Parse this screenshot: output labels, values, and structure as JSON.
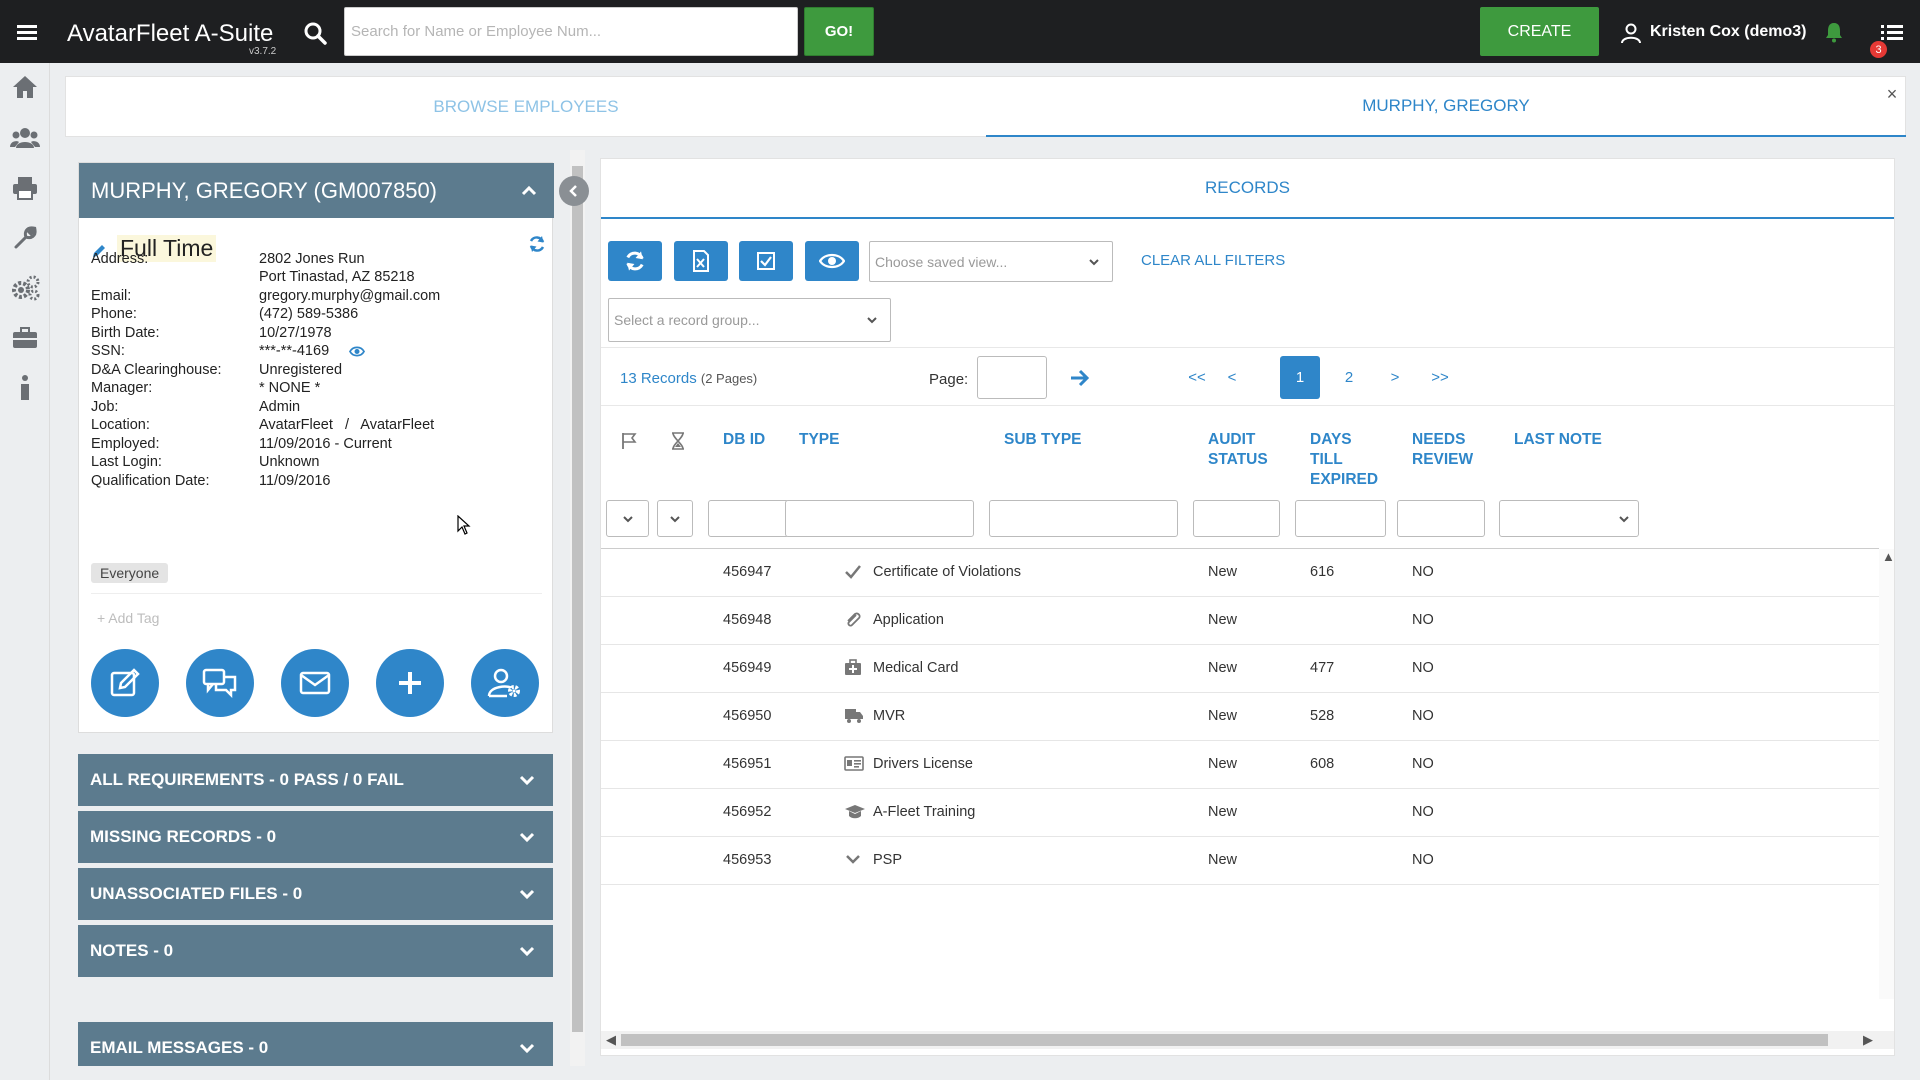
{
  "header": {
    "app_title": "AvatarFleet A-Suite",
    "version": "v3.7.2",
    "search_placeholder": "Search for Name or Employee Num...",
    "go_label": "GO!",
    "create_label": "CREATE",
    "user_name": "Kristen Cox (demo3)",
    "notification_count": "3"
  },
  "sidebar": {
    "items": [
      "home-icon",
      "users-icon",
      "print-icon",
      "wrench-icon",
      "gears-icon",
      "briefcase-icon",
      "info-icon"
    ]
  },
  "tabs": {
    "browse": "BROWSE EMPLOYEES",
    "employee": "MURPHY, GREGORY",
    "close": "×"
  },
  "employee": {
    "header": "MURPHY, GREGORY (GM007850)",
    "status": "Full Time",
    "fields": [
      {
        "label": "Address:",
        "value": "2802 Jones Run"
      },
      {
        "label": "",
        "value": "Port Tinastad, AZ 85218"
      },
      {
        "label": "Email:",
        "value": "gregory.murphy@gmail.com"
      },
      {
        "label": "Phone:",
        "value": "(472) 589-5386"
      },
      {
        "label": "Birth Date:",
        "value": "10/27/1978"
      },
      {
        "label": "SSN:",
        "value": "***-**-4169"
      },
      {
        "label": "D&A Clearinghouse:",
        "value": "Unregistered"
      },
      {
        "label": "Manager:",
        "value": "* NONE *"
      },
      {
        "label": "Job:",
        "value": "Admin"
      },
      {
        "label": "Location:",
        "value": "AvatarFleet   /   AvatarFleet"
      },
      {
        "label": "Employed:",
        "value": "11/09/2016 - Current"
      },
      {
        "label": "Last Login:",
        "value": "Unknown"
      },
      {
        "label": "Qualification Date:",
        "value": "11/09/2016"
      }
    ],
    "tag": "Everyone",
    "add_tag": "+ Add Tag",
    "action_buttons": [
      "edit-icon",
      "chat-icon",
      "mail-icon",
      "plus-icon",
      "user-settings-icon"
    ]
  },
  "accordions": [
    "ALL REQUIREMENTS - 0 PASS / 0 FAIL",
    "MISSING RECORDS - 0",
    "UNASSOCIATED FILES - 0",
    "NOTES - 0",
    "EMAIL MESSAGES - 0"
  ],
  "records": {
    "tab": "RECORDS",
    "saved_view_placeholder": "Choose saved view...",
    "clear_filters": "CLEAR ALL FILTERS",
    "record_group_placeholder": "Select a record group...",
    "count": "13 Records",
    "pages": "(2 Pages)",
    "page_label": "Page:",
    "pagination": [
      "<<",
      "<",
      "1",
      "2",
      ">",
      ">>"
    ],
    "columns": {
      "db_id": "DB ID",
      "type": "TYPE",
      "sub_type": "SUB TYPE",
      "audit_status": [
        "AUDIT",
        "STATUS"
      ],
      "days_till_expired": [
        "DAYS",
        "TILL",
        "EXPIRED"
      ],
      "needs_review": [
        "NEEDS",
        "REVIEW"
      ],
      "last_note": "LAST NOTE"
    },
    "rows": [
      {
        "db_id": "456947",
        "icon": "check-icon",
        "type": "Certificate of Violations",
        "audit": "New",
        "days": "616",
        "review": "NO"
      },
      {
        "db_id": "456948",
        "icon": "paperclip-icon",
        "type": "Application",
        "audit": "New",
        "days": "",
        "review": "NO"
      },
      {
        "db_id": "456949",
        "icon": "medkit-icon",
        "type": "Medical Card",
        "audit": "New",
        "days": "477",
        "review": "NO"
      },
      {
        "db_id": "456950",
        "icon": "truck-icon",
        "type": "MVR",
        "audit": "New",
        "days": "528",
        "review": "NO"
      },
      {
        "db_id": "456951",
        "icon": "id-card-icon",
        "type": "Drivers License",
        "audit": "New",
        "days": "608",
        "review": "NO"
      },
      {
        "db_id": "456952",
        "icon": "graduation-cap-icon",
        "type": "A-Fleet Training",
        "audit": "New",
        "days": "",
        "review": "NO"
      },
      {
        "db_id": "456953",
        "icon": "chevron-down-icon",
        "type": "PSP",
        "audit": "New",
        "days": "",
        "review": "NO"
      }
    ]
  },
  "colors": {
    "topbar": "#1e1f21",
    "accent_blue": "#2f86c9",
    "green": "#3e9a3e",
    "panel_header": "#5c7b8e"
  }
}
